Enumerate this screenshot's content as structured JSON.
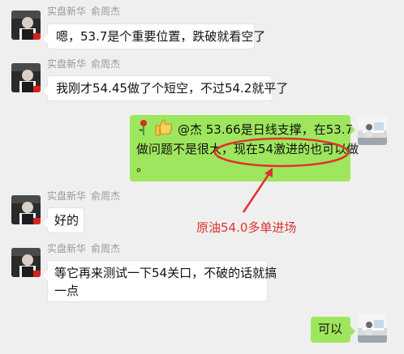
{
  "messages": [
    {
      "sender": {
        "name": "实盘新华",
        "remark": "俞周杰"
      },
      "text_lines": [
        "嗯，53.7是个重要位置，跌破就看空了"
      ],
      "side": "left"
    },
    {
      "sender": {
        "name": "实盘新华",
        "remark": "俞周杰"
      },
      "text_lines": [
        "我刚才54.45做了个短空，不过54.2就平了"
      ],
      "side": "left"
    },
    {
      "side": "right",
      "text_lines": [
        "@杰 53.66是日线支撑，在53.7",
        "做问题不是很大，现在54激进的也可以做",
        "。"
      ]
    },
    {
      "sender": {
        "name": "实盘新华",
        "remark": "俞周杰"
      },
      "text_lines": [
        "好的"
      ],
      "side": "left"
    },
    {
      "sender": {
        "name": "实盘新华",
        "remark": "俞周杰"
      },
      "text_lines": [
        "等它再来测试一下54关口，不破的话就搞",
        "一点"
      ],
      "side": "left"
    },
    {
      "side": "right",
      "text_lines": [
        "可以"
      ]
    }
  ],
  "annotation": {
    "text": "原油54.0多单进场",
    "color": "#e0322e"
  },
  "emojis": [
    "rose-icon",
    "thumbs-up-icon"
  ]
}
